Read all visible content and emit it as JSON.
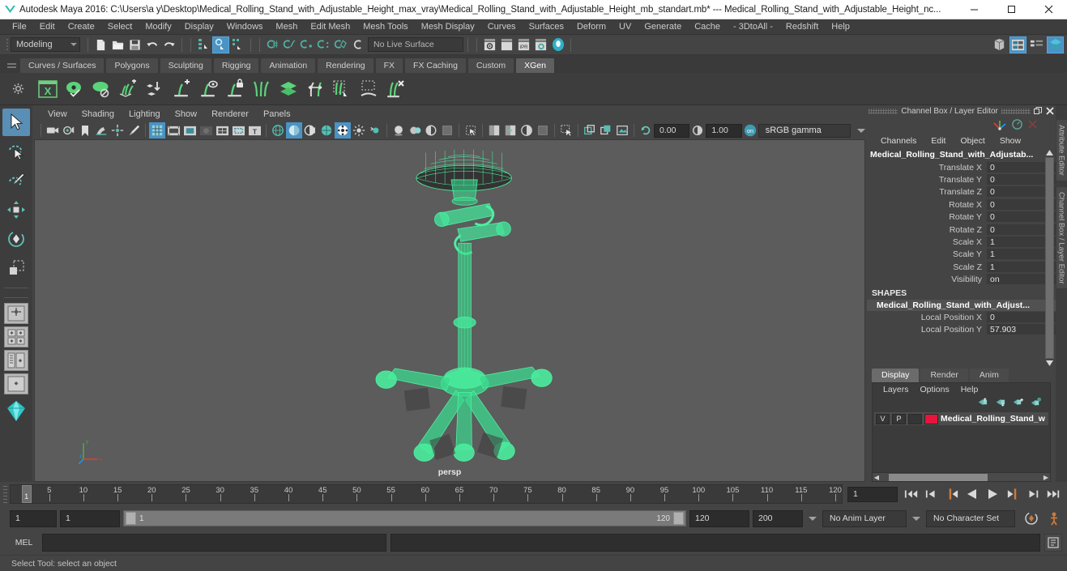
{
  "window": {
    "title": "Autodesk Maya 2016: C:\\Users\\a y\\Desktop\\Medical_Rolling_Stand_with_Adjustable_Height_max_vray\\Medical_Rolling_Stand_with_Adjustable_Height_mb_standart.mb*  ---  Medical_Rolling_Stand_with_Adjustable_Height_nc...",
    "minimize": "—",
    "maximize": "❐",
    "close": "✕",
    "logo_color": "#2fb9b3"
  },
  "menubar": {
    "items": [
      "File",
      "Edit",
      "Create",
      "Select",
      "Modify",
      "Display",
      "Windows",
      "Mesh",
      "Edit Mesh",
      "Mesh Tools",
      "Mesh Display",
      "Curves",
      "Surfaces",
      "Deform",
      "UV",
      "Generate",
      "Cache",
      "- 3DtoAll -",
      "Redshift",
      "Help"
    ]
  },
  "statusbar": {
    "menuset": "Modeling",
    "live_surface": "No Live Surface",
    "icons": [
      "new-scene-icon",
      "open-scene-icon",
      "save-scene-icon",
      "undo-icon",
      "redo-icon",
      "select-by-hierarchy-icon",
      "select-by-object-icon",
      "select-by-component-icon",
      "snap-to-grid-icon",
      "snap-to-curve-icon",
      "snap-to-point-icon",
      "snap-to-projected-center-icon",
      "snap-to-view-plane-icon",
      "make-live-icon",
      "render-current-frame-icon",
      "ipr-render-icon",
      "render-settings-icon",
      "hypershade-icon",
      "render-view-icon"
    ],
    "right_icons": [
      "show-hide-editors-icon",
      "attribute-editor-icon",
      "tool-settings-icon",
      "channel-box-icon"
    ]
  },
  "shelf": {
    "tabs": [
      "Curves / Surfaces",
      "Polygons",
      "Sculpting",
      "Rigging",
      "Animation",
      "Rendering",
      "FX",
      "FX Caching",
      "Custom",
      "XGen"
    ],
    "active_tab": "XGen",
    "icons": [
      "xgen-editor-icon",
      "xgen-preview-icon",
      "xgen-disable-preview-icon",
      "xgen-add-density-icon",
      "xgen-place-icon",
      "xgen-add-guide-icon",
      "xgen-guide-display-icon",
      "xgen-lock-guide-icon",
      "xgen-comb-icon",
      "xgen-layers-icon",
      "xgen-length-icon",
      "xgen-select-guides-icon",
      "xgen-region-icon",
      "xgen-delete-guides-icon"
    ]
  },
  "toolbox": {
    "items": [
      {
        "name": "select-tool",
        "selected": true
      },
      {
        "name": "lasso-select-tool",
        "selected": false
      },
      {
        "name": "paint-select-tool",
        "selected": false
      },
      {
        "name": "move-tool",
        "selected": false
      },
      {
        "name": "rotate-tool",
        "selected": false
      },
      {
        "name": "scale-tool",
        "selected": false
      }
    ],
    "layout_buttons": [
      "single-perspective-layout",
      "four-view-layout",
      "persp-outliner-layout",
      "persp-graph-layout"
    ]
  },
  "viewport": {
    "menu": [
      "View",
      "Shading",
      "Lighting",
      "Show",
      "Renderer",
      "Panels"
    ],
    "exposure": "0.00",
    "gamma": "1.00",
    "color_management": "sRGB gamma",
    "camera_label": "persp",
    "background": "#5c5c5c",
    "model_color": "#5cf0a8",
    "axis": {
      "x": "x",
      "y": "y",
      "z": "z"
    },
    "toolbar_icons": [
      "select-camera-icon",
      "lock-camera-icon",
      "bookmark-icon",
      "image-plane-icon",
      "two-d-pan-zoom-icon",
      "oil-paint-icon",
      "grid-icon",
      "film-gate-icon",
      "resolution-gate-icon",
      "gate-mask-icon",
      "film-origin-icon",
      "safe-action-icon",
      "safe-title-icon",
      "wireframe-icon",
      "smooth-shade-all-icon",
      "shade-selected-icon",
      "wireframe-on-shaded-icon",
      "texture-icon",
      "use-default-light-icon",
      "use-all-lights-icon",
      "shadows-icon",
      "screen-space-ao-icon",
      "motion-blur-icon",
      "multisample-icon",
      "isolate-select-icon",
      "xray-icon",
      "xray-joints-icon",
      "xray-active-components-icon",
      "exposure-icon",
      "gamma-icon",
      "color-management-icon"
    ]
  },
  "channelbox": {
    "panel_title": "Channel Box / Layer Editor",
    "undock_icon": "undock-icon",
    "close_icon": "close-icon",
    "menu": [
      "Channels",
      "Edit",
      "Object",
      "Show"
    ],
    "object_name": "Medical_Rolling_Stand_with_Adjustab...",
    "transforms": [
      {
        "label": "Translate X",
        "value": "0"
      },
      {
        "label": "Translate Y",
        "value": "0"
      },
      {
        "label": "Translate Z",
        "value": "0"
      },
      {
        "label": "Rotate X",
        "value": "0"
      },
      {
        "label": "Rotate Y",
        "value": "0"
      },
      {
        "label": "Rotate Z",
        "value": "0"
      },
      {
        "label": "Scale X",
        "value": "1"
      },
      {
        "label": "Scale Y",
        "value": "1"
      },
      {
        "label": "Scale Z",
        "value": "1"
      },
      {
        "label": "Visibility",
        "value": "on"
      }
    ],
    "shapes_header": "SHAPES",
    "shape_name": "Medical_Rolling_Stand_with_Adjust...",
    "shape_attrs": [
      {
        "label": "Local Position X",
        "value": "0"
      },
      {
        "label": "Local Position Y",
        "value": "57.903"
      }
    ]
  },
  "layereditor": {
    "tabs": [
      "Display",
      "Render",
      "Anim"
    ],
    "active_tab": "Display",
    "menu": [
      "Layers",
      "Options",
      "Help"
    ],
    "buttons": [
      "layer-move-up-icon",
      "layer-move-down-icon",
      "create-empty-layer-icon",
      "create-layer-from-selected-icon"
    ],
    "layers": [
      {
        "visibility": "V",
        "playback": "P",
        "type": "",
        "color": "#e8143c",
        "name": "Medical_Rolling_Stand_w"
      }
    ]
  },
  "right_tabs": [
    "Attribute Editor",
    "Channel Box / Layer Editor"
  ],
  "timeslider": {
    "ticks": [
      5,
      10,
      15,
      20,
      25,
      30,
      35,
      40,
      45,
      50,
      55,
      60,
      65,
      70,
      75,
      80,
      85,
      90,
      95,
      100,
      105,
      110,
      115,
      120
    ],
    "start": 1,
    "end": 120,
    "current_frame": "1",
    "current_frame_field": "1",
    "playhead_label": "1",
    "transport": [
      "go-to-start-icon",
      "step-back-keyframe-icon",
      "step-back-frame-icon",
      "play-backwards-icon",
      "play-forwards-icon",
      "step-forward-frame-icon",
      "step-forward-keyframe-icon",
      "go-to-end-icon"
    ]
  },
  "rangeslider": {
    "anim_start": "1",
    "range_start": "1",
    "bar_start": "1",
    "bar_end": "120",
    "range_end": "120",
    "anim_end": "200",
    "anim_layer": "No Anim Layer",
    "character_set": "No Character Set",
    "auto_key_icon": "auto-keyframe-icon",
    "anim_prefs_icon": "animation-preferences-icon"
  },
  "commandline": {
    "language": "MEL",
    "input_value": "",
    "output_value": "",
    "script_editor_icon": "script-editor-icon"
  },
  "helpline": {
    "text": "Select Tool: select an object"
  }
}
